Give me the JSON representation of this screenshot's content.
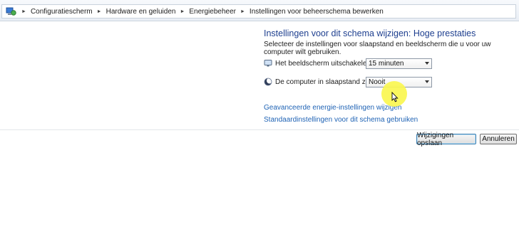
{
  "breadcrumb": {
    "items": [
      {
        "label": "Configuratiescherm"
      },
      {
        "label": "Hardware en geluiden"
      },
      {
        "label": "Energiebeheer"
      },
      {
        "label": "Instellingen voor beheerschema bewerken"
      }
    ]
  },
  "main": {
    "title": "Instellingen voor dit schema wijzigen: Hoge prestaties",
    "subtitle": "Selecteer de instellingen voor slaapstand en beeldscherm die u voor uw computer wilt gebruiken.",
    "display_off": {
      "label": "Het beeldscherm uitschakelen na:",
      "value": "15 minuten",
      "icon": "monitor-icon"
    },
    "sleep": {
      "label": "De computer in slaapstand zetten na:",
      "value": "Nooit",
      "icon": "moon-icon"
    },
    "link_advanced": "Geavanceerde energie-instellingen wijzigen",
    "link_restore": "Standaardinstellingen voor dit schema gebruiken"
  },
  "footer": {
    "save_label": "Wijzigingen opslaan",
    "cancel_label": "Annuleren"
  },
  "colors": {
    "title": "#1e3f8f",
    "link": "#1f63b5",
    "cursor_highlight": "#faf650"
  }
}
